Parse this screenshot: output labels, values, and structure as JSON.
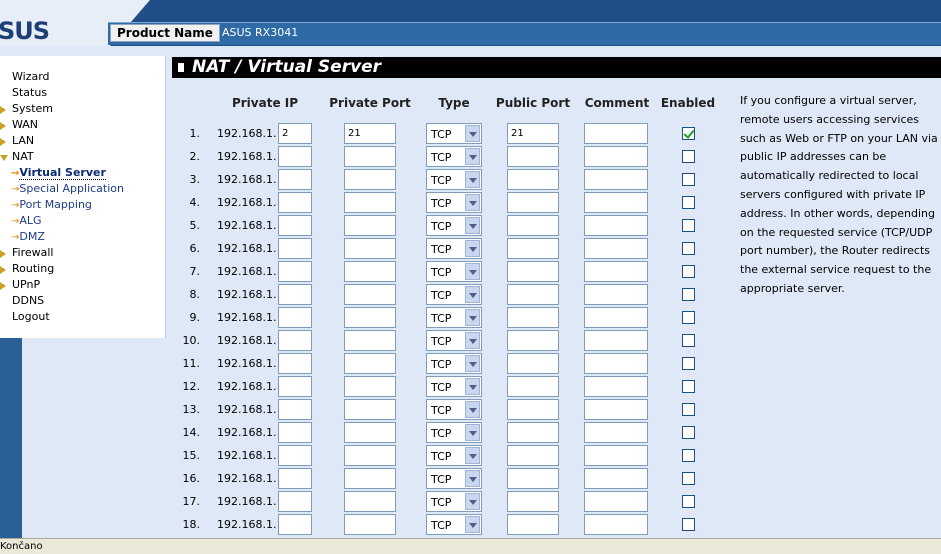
{
  "header": {
    "logo_text": "SUS",
    "product_name_label": "Product Name",
    "product_name_value": "ASUS RX3041"
  },
  "nav": {
    "items": [
      {
        "label": "Wizard",
        "arrow": "none"
      },
      {
        "label": "Status",
        "arrow": "none"
      },
      {
        "label": "System",
        "arrow": "right"
      },
      {
        "label": "WAN",
        "arrow": "right"
      },
      {
        "label": "LAN",
        "arrow": "right"
      },
      {
        "label": "NAT",
        "arrow": "down"
      }
    ],
    "sub_items": [
      {
        "label": "Virtual Server",
        "active": true
      },
      {
        "label": "Special Application",
        "active": false
      },
      {
        "label": "Port Mapping",
        "active": false
      },
      {
        "label": "ALG",
        "active": false
      },
      {
        "label": "DMZ",
        "active": false
      }
    ],
    "items_after": [
      {
        "label": "Firewall",
        "arrow": "right"
      },
      {
        "label": "Routing",
        "arrow": "right"
      },
      {
        "label": "UPnP",
        "arrow": "right"
      },
      {
        "label": "DDNS",
        "arrow": "none"
      },
      {
        "label": "Logout",
        "arrow": "none"
      }
    ]
  },
  "page_title": "NAT / Virtual Server",
  "table": {
    "headers": {
      "private_ip": "Private IP",
      "private_port": "Private Port",
      "type": "Type",
      "public_port": "Public Port",
      "comment": "Comment",
      "enabled": "Enabled"
    },
    "ip_prefix": "192.168.1.",
    "rows": [
      {
        "num": "1.",
        "ip": "2",
        "private_port": "21",
        "type": "TCP",
        "public_port": "21",
        "comment": "",
        "enabled": true
      },
      {
        "num": "2.",
        "ip": "",
        "private_port": "",
        "type": "TCP",
        "public_port": "",
        "comment": "",
        "enabled": false
      },
      {
        "num": "3.",
        "ip": "",
        "private_port": "",
        "type": "TCP",
        "public_port": "",
        "comment": "",
        "enabled": false
      },
      {
        "num": "4.",
        "ip": "",
        "private_port": "",
        "type": "TCP",
        "public_port": "",
        "comment": "",
        "enabled": false
      },
      {
        "num": "5.",
        "ip": "",
        "private_port": "",
        "type": "TCP",
        "public_port": "",
        "comment": "",
        "enabled": false
      },
      {
        "num": "6.",
        "ip": "",
        "private_port": "",
        "type": "TCP",
        "public_port": "",
        "comment": "",
        "enabled": false
      },
      {
        "num": "7.",
        "ip": "",
        "private_port": "",
        "type": "TCP",
        "public_port": "",
        "comment": "",
        "enabled": false
      },
      {
        "num": "8.",
        "ip": "",
        "private_port": "",
        "type": "TCP",
        "public_port": "",
        "comment": "",
        "enabled": false
      },
      {
        "num": "9.",
        "ip": "",
        "private_port": "",
        "type": "TCP",
        "public_port": "",
        "comment": "",
        "enabled": false
      },
      {
        "num": "10.",
        "ip": "",
        "private_port": "",
        "type": "TCP",
        "public_port": "",
        "comment": "",
        "enabled": false
      },
      {
        "num": "11.",
        "ip": "",
        "private_port": "",
        "type": "TCP",
        "public_port": "",
        "comment": "",
        "enabled": false
      },
      {
        "num": "12.",
        "ip": "",
        "private_port": "",
        "type": "TCP",
        "public_port": "",
        "comment": "",
        "enabled": false
      },
      {
        "num": "13.",
        "ip": "",
        "private_port": "",
        "type": "TCP",
        "public_port": "",
        "comment": "",
        "enabled": false
      },
      {
        "num": "14.",
        "ip": "",
        "private_port": "",
        "type": "TCP",
        "public_port": "",
        "comment": "",
        "enabled": false
      },
      {
        "num": "15.",
        "ip": "",
        "private_port": "",
        "type": "TCP",
        "public_port": "",
        "comment": "",
        "enabled": false
      },
      {
        "num": "16.",
        "ip": "",
        "private_port": "",
        "type": "TCP",
        "public_port": "",
        "comment": "",
        "enabled": false
      },
      {
        "num": "17.",
        "ip": "",
        "private_port": "",
        "type": "TCP",
        "public_port": "",
        "comment": "",
        "enabled": false
      },
      {
        "num": "18.",
        "ip": "",
        "private_port": "",
        "type": "TCP",
        "public_port": "",
        "comment": "",
        "enabled": false
      }
    ]
  },
  "info_text": "If you configure a virtual server, remote users accessing services such as Web or FTP on your LAN via public IP addresses can be automatically redirected to local servers configured with private IP address. In other words, depending on the requested service (TCP/UDP port number), the Router redirects the external service request to the appropriate server.",
  "status_bar": "Končano",
  "colors": {
    "header_blue": "#1f4f86",
    "title_bar_blue": "#2e6aa6",
    "page_bg": "#dfe8f6",
    "page_title_bg": "#000000",
    "nav_arrow": "#c8a02a",
    "sub_arrow": "#e08a00",
    "checkbox_check": "#21a121"
  }
}
